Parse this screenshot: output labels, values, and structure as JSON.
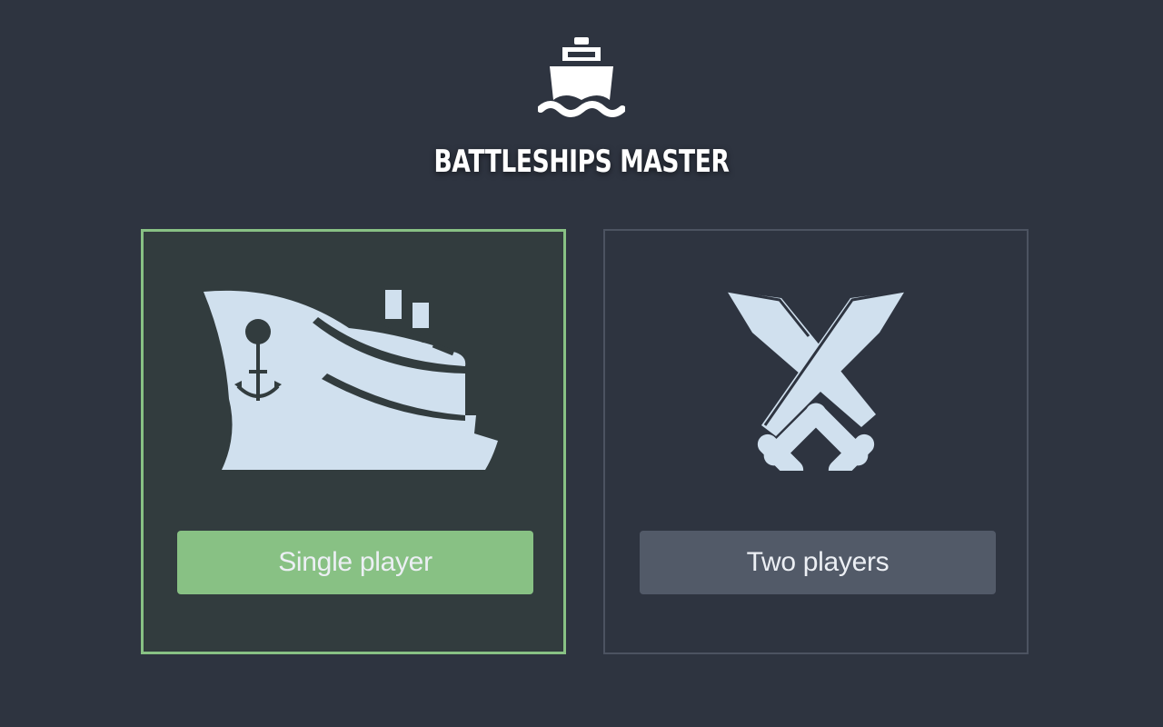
{
  "app": {
    "title": "BATTLESHIPS MASTER",
    "logo_icon": "ship-on-waves-icon"
  },
  "modes": [
    {
      "id": "single",
      "icon": "cruise-ship-icon",
      "button_label": "Single player",
      "selected": true
    },
    {
      "id": "two",
      "icon": "crossed-swords-icon",
      "button_label": "Two players",
      "selected": false
    }
  ],
  "colors": {
    "background": "#2e3440",
    "accent_green": "#88c184",
    "selected_card_bg": "#323c3e",
    "secondary_button": "#525a68",
    "icon_fill": "#d0e0ee",
    "text": "#eceff4"
  }
}
